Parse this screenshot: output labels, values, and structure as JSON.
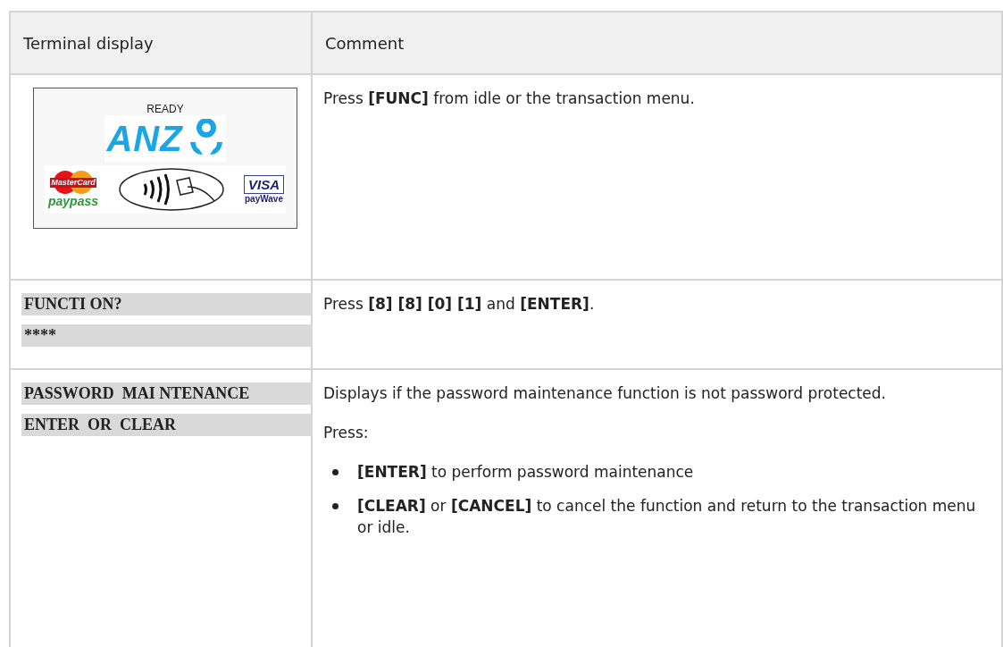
{
  "table": {
    "columns": [
      "Terminal display",
      "Comment"
    ],
    "rows": [
      {
        "display": {
          "kind": "idle_screen",
          "status": "READY",
          "bank_logo": "ANZ",
          "card_logo": "MasterCard",
          "left_mark": "paypass",
          "right_mark": "VISA",
          "right_caption": "payWave"
        },
        "comment": [
          {
            "kind": "text",
            "text": "Press **[FUNC]** from idle or the transaction menu."
          }
        ]
      },
      {
        "display": {
          "kind": "lines",
          "lines": [
            "FUNCTI ON?",
            "****"
          ]
        },
        "comment": [
          {
            "kind": "text",
            "text": "Press **[8] [8] [0] [1]** and **[ENTER]**."
          }
        ]
      },
      {
        "display": {
          "kind": "lines",
          "lines": [
            "PASSWORD  MAI NTENANCE",
            "ENTER  OR  CLEAR"
          ]
        },
        "comment": [
          {
            "kind": "text",
            "text": "Displays if the password maintenance function is not password protected."
          },
          {
            "kind": "text",
            "text": "Press:"
          },
          {
            "kind": "bullet",
            "text": "**[ENTER]** to perform password maintenance"
          },
          {
            "kind": "bullet",
            "text": "**[CLEAR]** or **[CANCEL]** to cancel the function and return to the transaction menu or idle."
          }
        ]
      }
    ]
  }
}
